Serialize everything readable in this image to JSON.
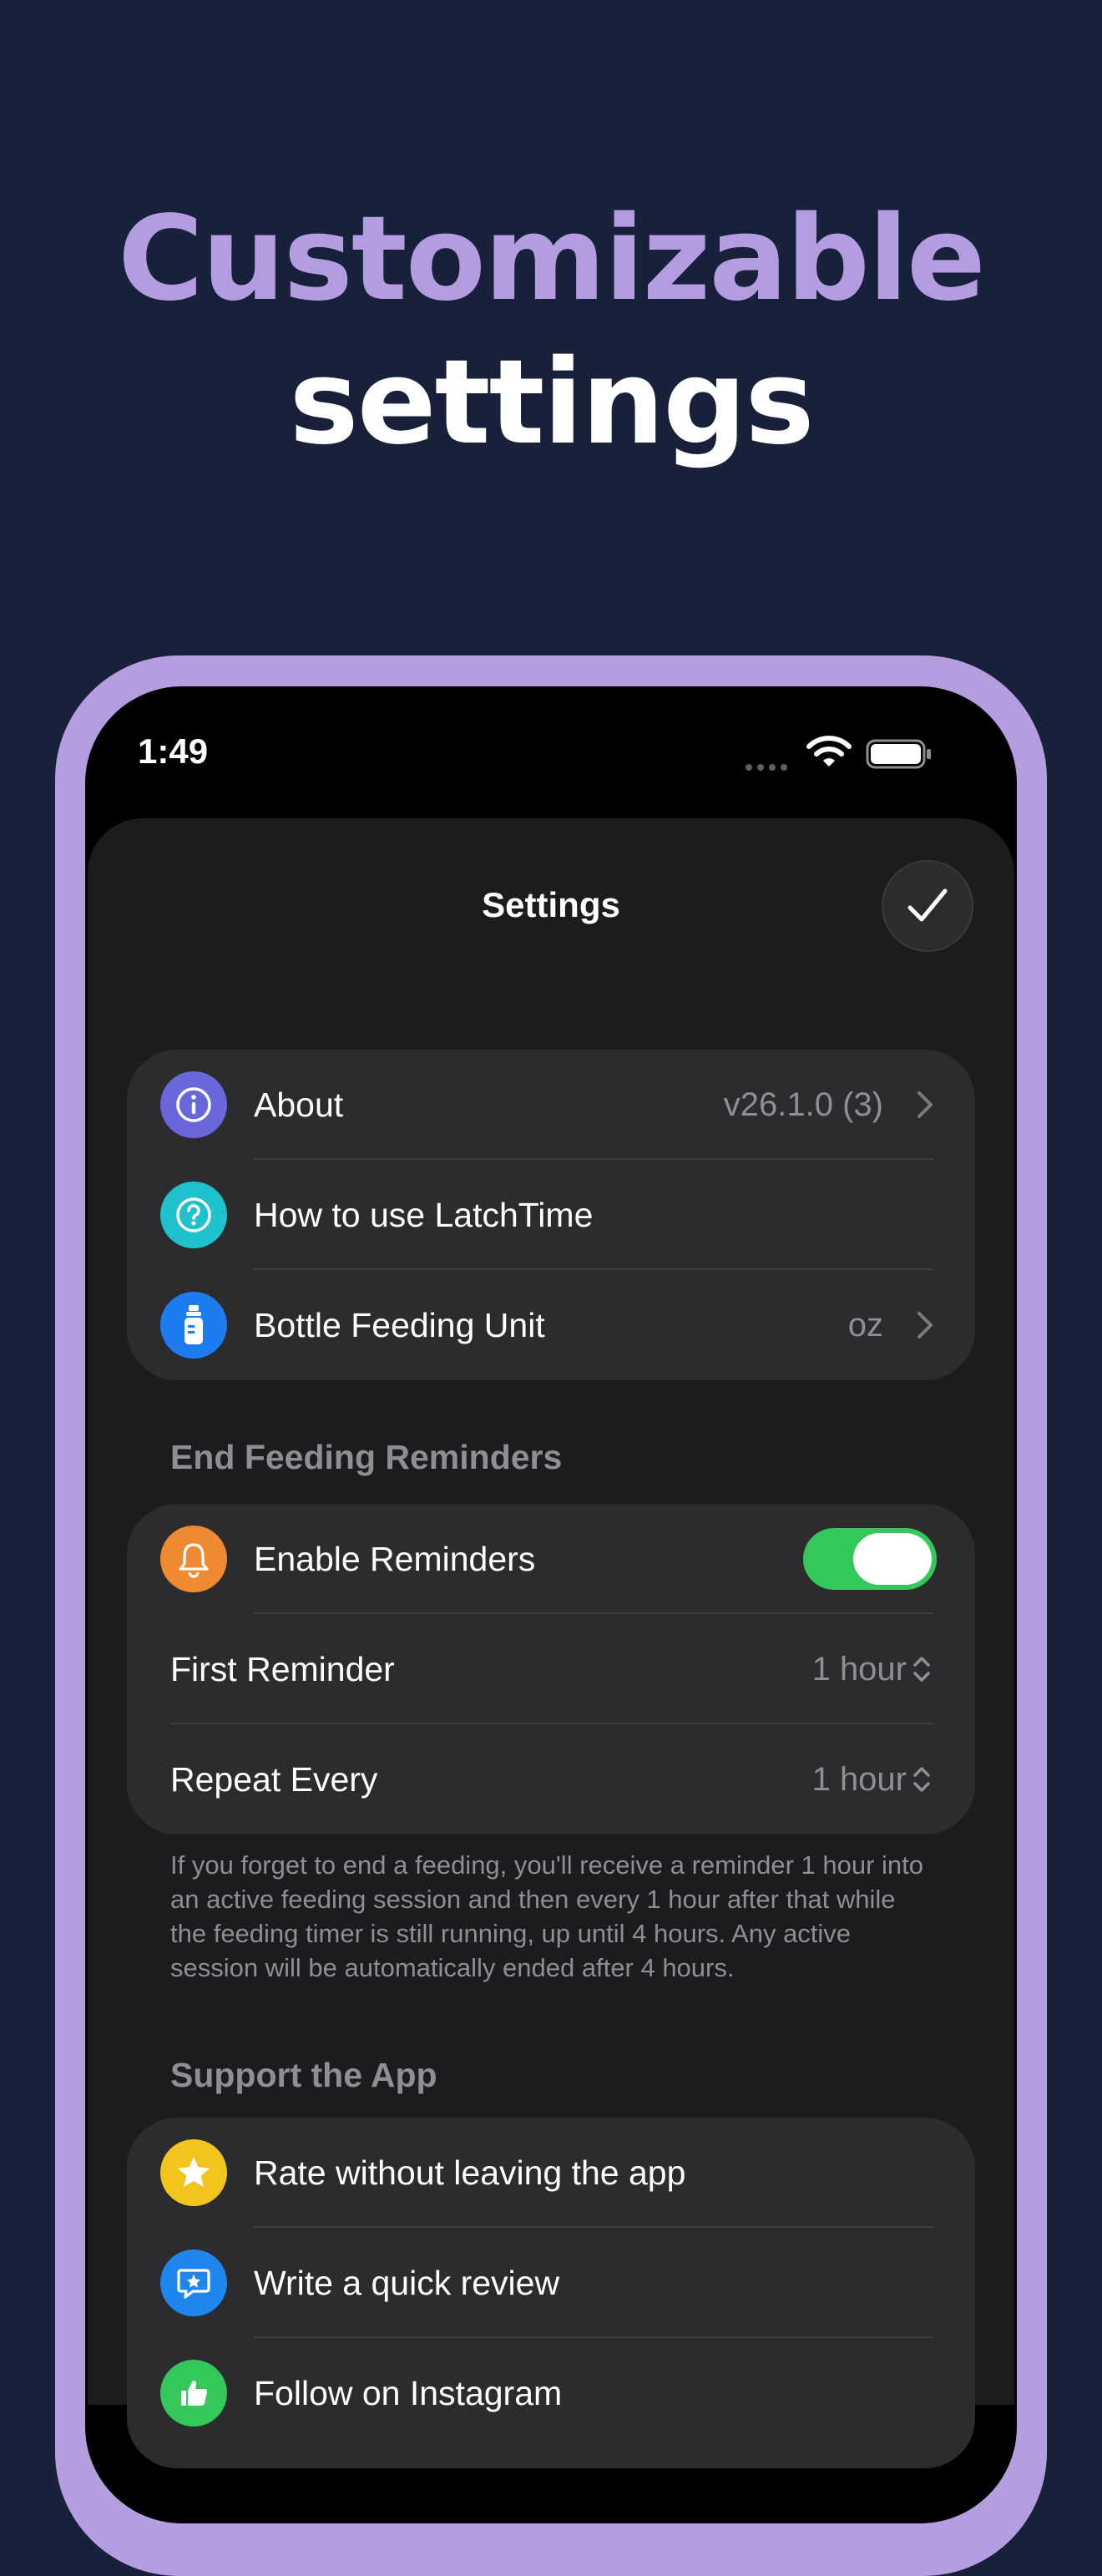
{
  "headline": {
    "line1": "Customizable",
    "line2": "settings"
  },
  "status_bar": {
    "time": "1:49"
  },
  "sheet": {
    "title": "Settings"
  },
  "group_general": [
    {
      "label": "About",
      "value": "v26.1.0 (3)",
      "icon": "info-icon",
      "color": "#6a67dd"
    },
    {
      "label": "How to use LatchTime",
      "value": "",
      "icon": "question-icon",
      "color": "#1fc1cc"
    },
    {
      "label": "Bottle Feeding Unit",
      "value": "oz",
      "icon": "bottle-icon",
      "color": "#1c7cf0"
    }
  ],
  "reminders": {
    "header": "End Feeding Reminders",
    "enable_label": "Enable Reminders",
    "enable_icon": "bell-icon",
    "enable_color": "#ef8a33",
    "enabled": true,
    "first_label": "First Reminder",
    "first_value": "1 hour",
    "repeat_label": "Repeat Every",
    "repeat_value": "1 hour",
    "footnote": "If you forget to end a feeding, you'll receive a reminder 1 hour into an active feeding session and then every 1 hour after that while the feeding timer is still running, up until 4 hours. Any active session will be automatically ended after 4 hours."
  },
  "support": {
    "header": "Support the App",
    "items": [
      {
        "label": "Rate without leaving the app",
        "icon": "star-icon",
        "color": "#f2c41c"
      },
      {
        "label": "Write a quick review",
        "icon": "review-bubble-icon",
        "color": "#1f86ee"
      },
      {
        "label": "Follow on Instagram",
        "icon": "thumbs-up-icon",
        "color": "#34c759"
      }
    ]
  }
}
